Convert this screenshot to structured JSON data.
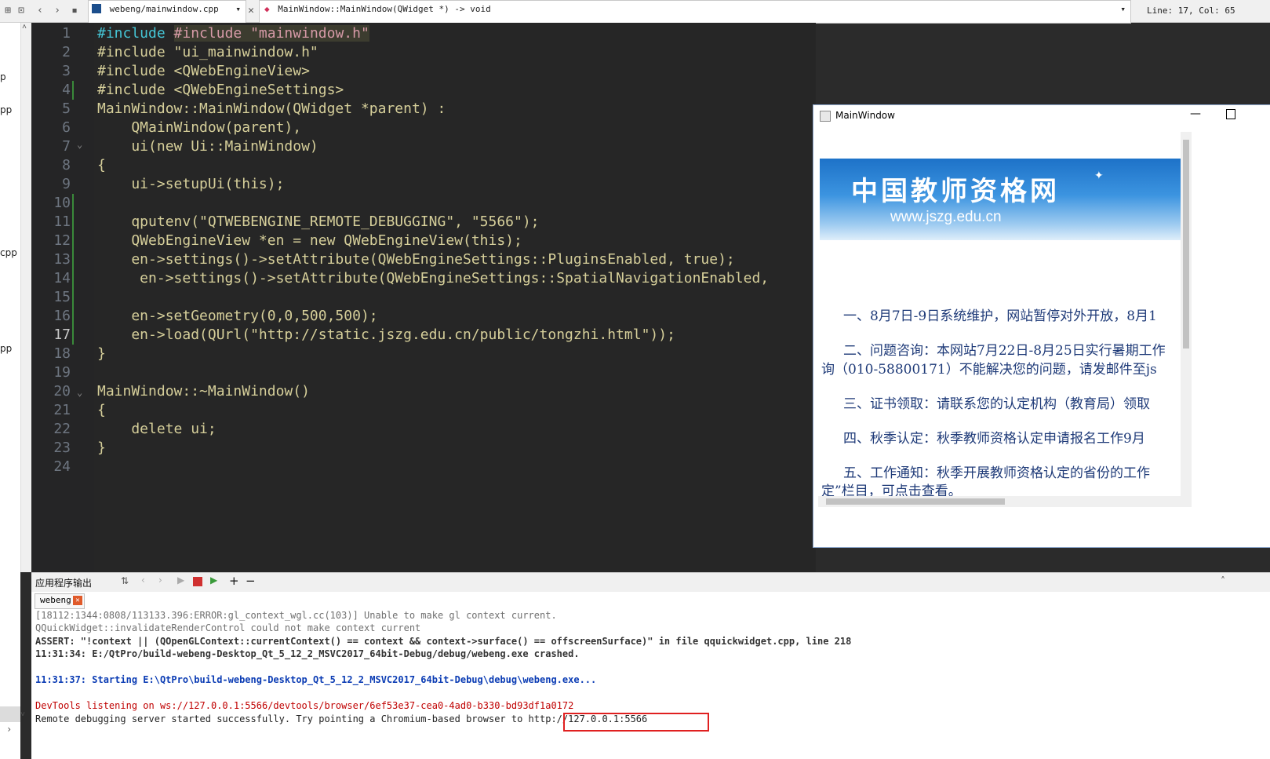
{
  "topbar": {
    "file_name": "webeng/mainwindow.cpp",
    "symbol": "MainWindow::MainWindow(QWidget *) -> void",
    "position": "Line: 17, Col: 65"
  },
  "left_strip": [
    "p",
    "pp",
    "cpp",
    "pp"
  ],
  "editor": {
    "current_line": 17,
    "line_numbers": [
      "1",
      "2",
      "3",
      "4",
      "5",
      "6",
      "7",
      "8",
      "9",
      "10",
      "11",
      "12",
      "13",
      "14",
      "15",
      "16",
      "17",
      "18",
      "19",
      "20",
      "21",
      "22",
      "23",
      "24"
    ],
    "lines": [
      "#include \"mainwindow.h\"",
      "#include \"ui_mainwindow.h\"",
      "#include <QWebEngineView>",
      "#include <QWebEngineSettings>",
      "MainWindow::MainWindow(QWidget *parent) :",
      "    QMainWindow(parent),",
      "    ui(new Ui::MainWindow)",
      "{",
      "    ui->setupUi(this);",
      "",
      "    qputenv(\"QTWEBENGINE_REMOTE_DEBUGGING\", \"5566\");",
      "    QWebEngineView *en = new QWebEngineView(this);",
      "    en->settings()->setAttribute(QWebEngineSettings::PluginsEnabled, true);",
      "     en->settings()->setAttribute(QWebEngineSettings::SpatialNavigationEnabled,",
      "",
      "    en->setGeometry(0,0,500,500);",
      "    en->load(QUrl(\"http://static.jszg.edu.cn/public/tongzhi.html\"));",
      "}",
      "",
      "MainWindow::~MainWindow()",
      "{",
      "    delete ui;",
      "}",
      ""
    ]
  },
  "app_window": {
    "title": "MainWindow",
    "banner_title": "中国教师资格网",
    "banner_url": "www.jszg.edu.cn",
    "paragraphs": [
      "一、8月7日-9日系统维护，网站暂停对外开放，8月1",
      "二、问题咨询：本网站7月22日-8月25日实行暑期工作",
      "询（010-58800171）不能解决您的问题，请发邮件至js",
      "三、证书领取：请联系您的认定机构（教育局）领取",
      "四、秋季认定：秋季教师资格认定申请报名工作9月",
      "五、工作通知：秋季开展教师资格认定的省份的工作",
      "定”栏目，可点击查看。"
    ]
  },
  "output_panel": {
    "title": "应用程序输出",
    "tab_label": "webeng",
    "lines": [
      "[18112:1344:0808/113133.396:ERROR:gl_context_wgl.cc(103)] Unable to make gl context current.",
      "QQuickWidget::invalidateRenderControl could not make context current",
      "ASSERT: \"!context || (QOpenGLContext::currentContext() == context && context->surface() == offscreenSurface)\" in file qquickwidget.cpp, line 218",
      "11:31:34: E:/QtPro/build-webeng-Desktop_Qt_5_12_2_MSVC2017_64bit-Debug/debug/webeng.exe crashed.",
      "",
      "11:31:37: Starting E:\\QtPro\\build-webeng-Desktop_Qt_5_12_2_MSVC2017_64bit-Debug\\debug\\webeng.exe...",
      "",
      "DevTools listening on ws://127.0.0.1:5566/devtools/browser/6ef53e37-cea0-4ad0-b330-bd93df1a0172",
      "Remote debugging server started successfully. Try pointing a Chromium-based browser to http://127.0.0.1:5566"
    ],
    "highlight_url": "http://127.0.0.1:5566"
  },
  "colors": {
    "editor_bg": "#262626",
    "keyword": "#45c6d6",
    "type": "#ff8080",
    "string_bg": "#3c3c2f",
    "error_text": "#c00000",
    "info_text": "#0b3cb4",
    "highlight_box": "#e02020"
  }
}
